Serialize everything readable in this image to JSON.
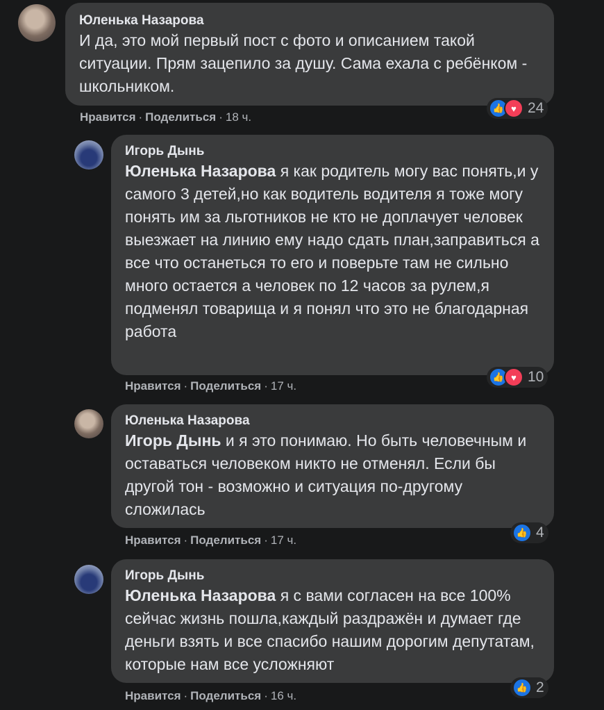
{
  "comments": [
    {
      "author": "Юленька Назарова",
      "mention": "",
      "text": "И да, это мой первый пост с фото и описанием такой ситуации. Прям зацепило за душу. Сама ехала с ребёнком - школьником.",
      "like_label": "Нравится",
      "share_label": "Поделиться",
      "time": "18 ч.",
      "reactions": [
        "like-icon",
        "love-icon"
      ],
      "reaction_count": "24"
    },
    {
      "author": "Игорь Дынь",
      "mention": "Юленька Назарова",
      "text": "я как родитель могу вас понять,и у самого 3 детей,но как водитель водителя я тоже могу понять им за льготников не кто не доплачует человек выезжает на линию ему надо сдать план,заправиться а все что останеться то его и поверьте там не сильно много остается а человек по 12 часов за рулем,я подменял товарища и я понял что это не благодарная работа",
      "like_label": "Нравится",
      "share_label": "Поделиться",
      "time": "17 ч.",
      "reactions": [
        "like-icon",
        "love-icon"
      ],
      "reaction_count": "10"
    },
    {
      "author": "Юленька Назарова",
      "mention": "Игорь Дынь",
      "text": "и я это понимаю. Но быть человечным и оставаться человеком никто не отменял. Если бы другой тон - возможно и ситуация по-другому сложилась",
      "like_label": "Нравится",
      "share_label": "Поделиться",
      "time": "17 ч.",
      "reactions": [
        "like-icon"
      ],
      "reaction_count": "4"
    },
    {
      "author": "Игорь Дынь",
      "mention": "Юленька Назарова",
      "text": "я с вами согласен на все 100% сейчас жизнь пошла,каждый раздражён и думает где деньги взять и все спасибо нашим дорогим депутатам, которые нам все усложняют",
      "like_label": "Нравится",
      "share_label": "Поделиться",
      "time": "16 ч.",
      "reactions": [
        "like-icon"
      ],
      "reaction_count": "2"
    }
  ]
}
